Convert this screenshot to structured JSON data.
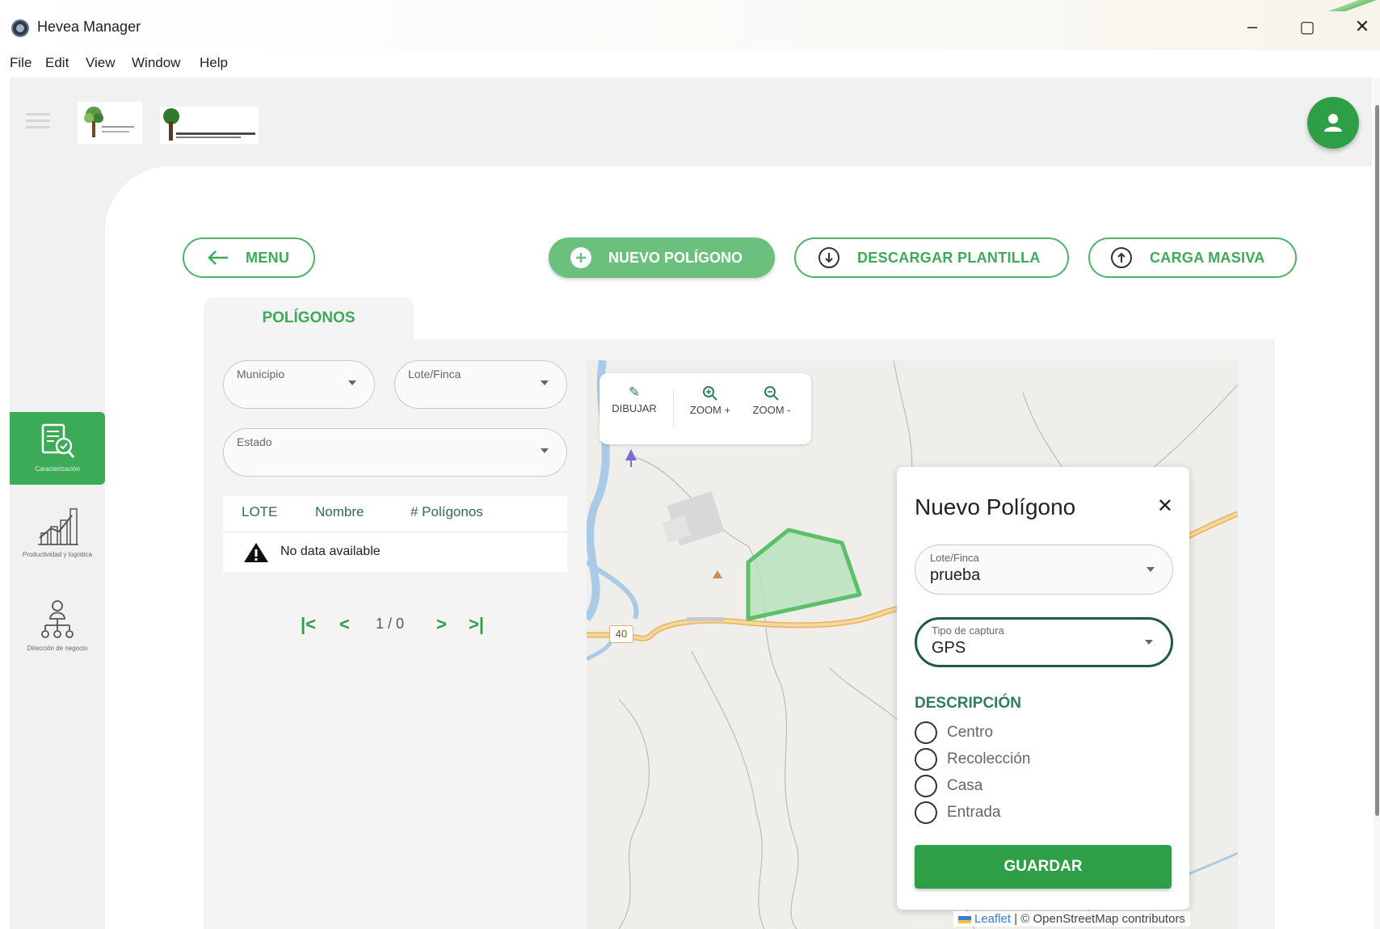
{
  "window": {
    "title": "Hevea Manager",
    "controls": {
      "minimize": "–",
      "maximize": "▢",
      "close": "✕"
    }
  },
  "menubar": {
    "items": [
      "File",
      "Edit",
      "View",
      "Window",
      "Help"
    ]
  },
  "sidebar": {
    "items": [
      {
        "label": "Caracterización",
        "icon": "document-check-icon",
        "active": true
      },
      {
        "label": "Productividad y logística",
        "icon": "chart-growth-icon",
        "active": false
      },
      {
        "label": "Dirección de negocio",
        "icon": "org-chart-icon",
        "active": false
      }
    ]
  },
  "actions": {
    "menu_label": "MENU",
    "new_polygon_label": "NUEVO POLÍGONO",
    "download_template_label": "DESCARGAR PLANTILLA",
    "bulk_upload_label": "CARGA MASIVA"
  },
  "tab": {
    "label": "POLÍGONOS"
  },
  "filters": {
    "municipio_label": "Municipio",
    "lote_finca_label": "Lote/Finca",
    "estado_label": "Estado"
  },
  "table": {
    "columns": [
      "LOTE",
      "Nombre",
      "# Polígonos"
    ],
    "empty_text": "No data available"
  },
  "pager": {
    "first": "|<",
    "prev": "<",
    "status": "1 / 0",
    "next": ">",
    "last": ">|"
  },
  "map": {
    "tools": [
      {
        "label": "DIBUJAR",
        "icon": "pencil-icon"
      },
      {
        "label": "ZOOM +",
        "icon": "zoom-in-icon"
      },
      {
        "label": "ZOOM -",
        "icon": "zoom-out-icon"
      }
    ],
    "road_label": "40",
    "attribution_leaflet": "Leaflet",
    "attribution_rest": "| © OpenStreetMap contributors"
  },
  "modal": {
    "title": "Nuevo Polígono",
    "close": "✕",
    "lote_label": "Lote/Finca",
    "lote_value": "prueba",
    "captura_label": "Tipo de captura",
    "captura_value": "GPS",
    "description_title": "DESCRIPCIÓN",
    "options": [
      "Centro",
      "Recolección",
      "Casa",
      "Entrada"
    ],
    "save_label": "GUARDAR"
  },
  "colors": {
    "accent": "#2e9e47",
    "accent_light": "#6cc07e",
    "outline": "#4db36a",
    "polygon": "#5cc06a"
  }
}
